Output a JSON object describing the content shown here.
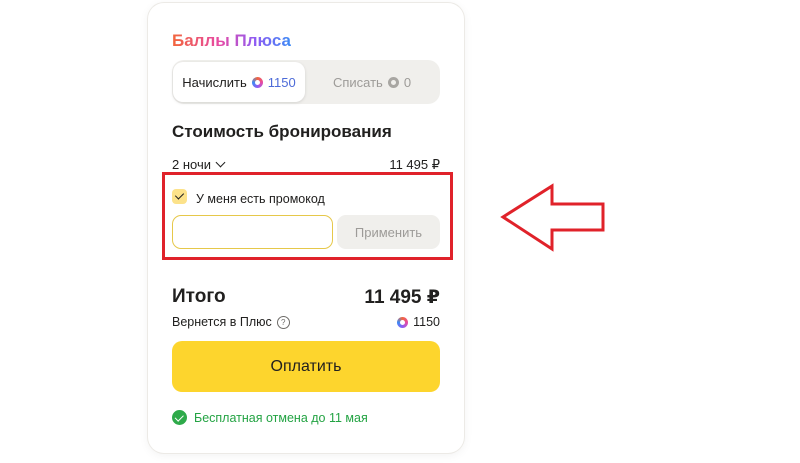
{
  "plus_points": {
    "title": "Баллы Плюса",
    "accrue": {
      "label": "Начислить",
      "icon": "plus-points-icon",
      "value": "1150",
      "active": true
    },
    "spend": {
      "label": "Списать",
      "icon": "plus-points-icon",
      "value": "0",
      "active": false
    }
  },
  "booking": {
    "title": "Стоимость бронирования",
    "nights_label": "2 ночи",
    "nights_price": "11 495 ₽"
  },
  "promo": {
    "checkbox_label": "У меня есть промокод",
    "checked": true,
    "input_value": "",
    "apply_label": "Применить"
  },
  "total": {
    "label": "Итого",
    "value": "11 495 ₽",
    "cashback_label": "Вернется в Плюс",
    "cashback_help_icon": "?",
    "cashback_value": "1150"
  },
  "pay_label": "Оплатить",
  "cancellation": "Бесплатная отмена до 11 мая",
  "colors": {
    "accent_yellow": "#fdd52d",
    "annotation_red": "#e0222a",
    "success_green": "#23a343"
  }
}
